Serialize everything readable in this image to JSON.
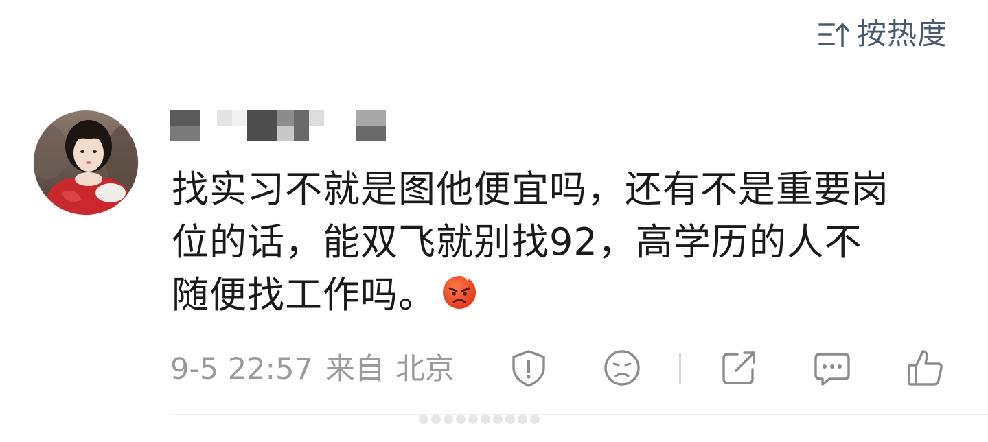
{
  "sort": {
    "icon": "sort-by-heat-icon",
    "label": "按热度"
  },
  "comment": {
    "avatar_icon": "user-avatar-photo",
    "username_obscured": true,
    "lines": [
      "找实习不就是图他便宜吗，还有不是重要岗",
      "位的话，能双飞就别找92，高学历的人不",
      "随便找工作吗。"
    ],
    "emoji": "angry-face-emoji",
    "timestamp": "9-5 22:57",
    "source_prefix": "来自",
    "location": "北京"
  },
  "actions": [
    {
      "name": "report-icon"
    },
    {
      "name": "dislike-face-icon"
    },
    {
      "name": "share-icon"
    },
    {
      "name": "reply-comment-icon"
    },
    {
      "name": "like-thumb-icon"
    }
  ],
  "colors": {
    "sort_text": "#4a5a6d",
    "body_text": "#1a1a1a",
    "meta_text": "#9b9b9b",
    "icon_stroke": "#8c8c8c",
    "emoji_fill": "#f04a23"
  }
}
